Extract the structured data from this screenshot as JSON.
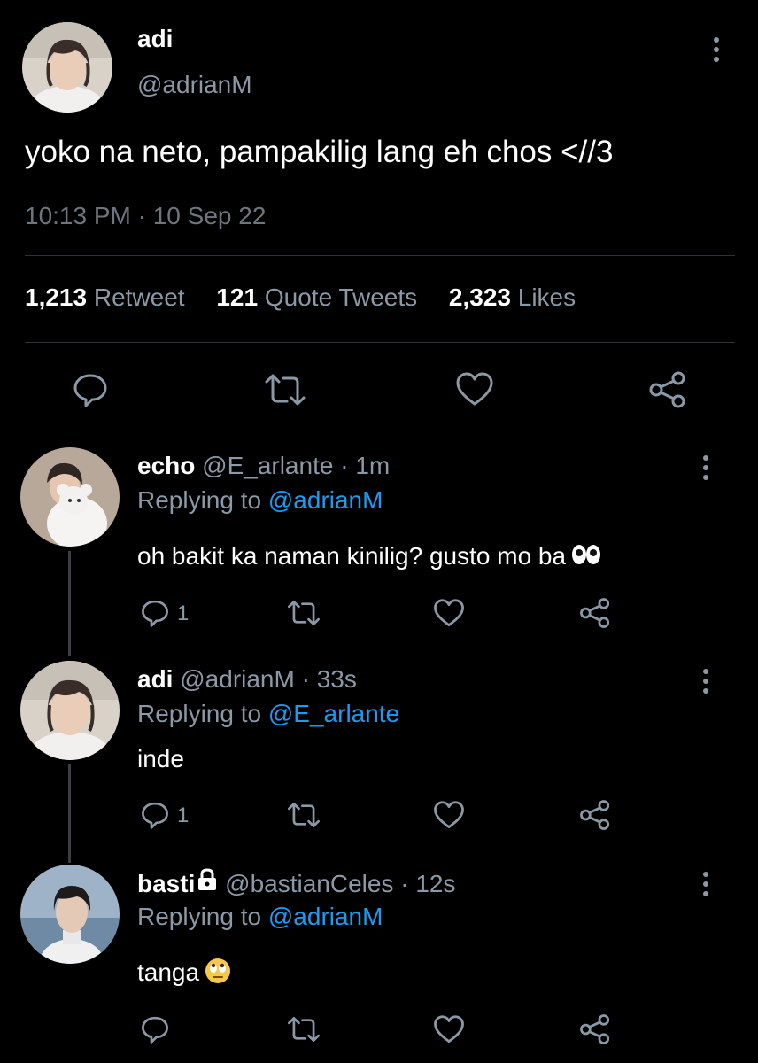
{
  "main_tweet": {
    "name": "adi",
    "handle": "@adrianM",
    "text": "yoko na neto, pampakilig lang eh chos <//3",
    "timestamp": "10:13 PM · 10 Sep 22",
    "stats": {
      "retweets_count": "1,213",
      "retweets_label": "Retweet",
      "quotes_count": "121",
      "quotes_label": "Quote Tweets",
      "likes_count": "2,323",
      "likes_label": "Likes"
    },
    "actions": [
      "reply-icon",
      "retweet-icon",
      "like-icon",
      "share-icon"
    ]
  },
  "replies": [
    {
      "name": "echo",
      "handle": "@E_arlante",
      "age": "· 1m",
      "replying_label": "Replying to",
      "replying_to": "@adrianM",
      "text": "oh bakit ka naman kinilig? gusto mo ba",
      "emoji": "eyes-emoji",
      "reply_count": "1"
    },
    {
      "name": "adi",
      "handle": "@adrianM",
      "age": "· 33s",
      "replying_label": "Replying to",
      "replying_to": "@E_arlante",
      "text": "inde",
      "reply_count": "1"
    },
    {
      "name": "basti",
      "lock_icon": "lock-icon",
      "handle": "@bastianCeles",
      "age": "· 12s",
      "replying_label": "Replying to",
      "replying_to": "@adrianM",
      "text": "tanga",
      "emoji": "rolling-eyes-emoji",
      "reply_count": ""
    }
  ],
  "colors": {
    "background": "#000000",
    "text": "#ffffff",
    "secondary": "#8b98a5",
    "link": "#1d9bf0",
    "divider": "#2f3336"
  }
}
